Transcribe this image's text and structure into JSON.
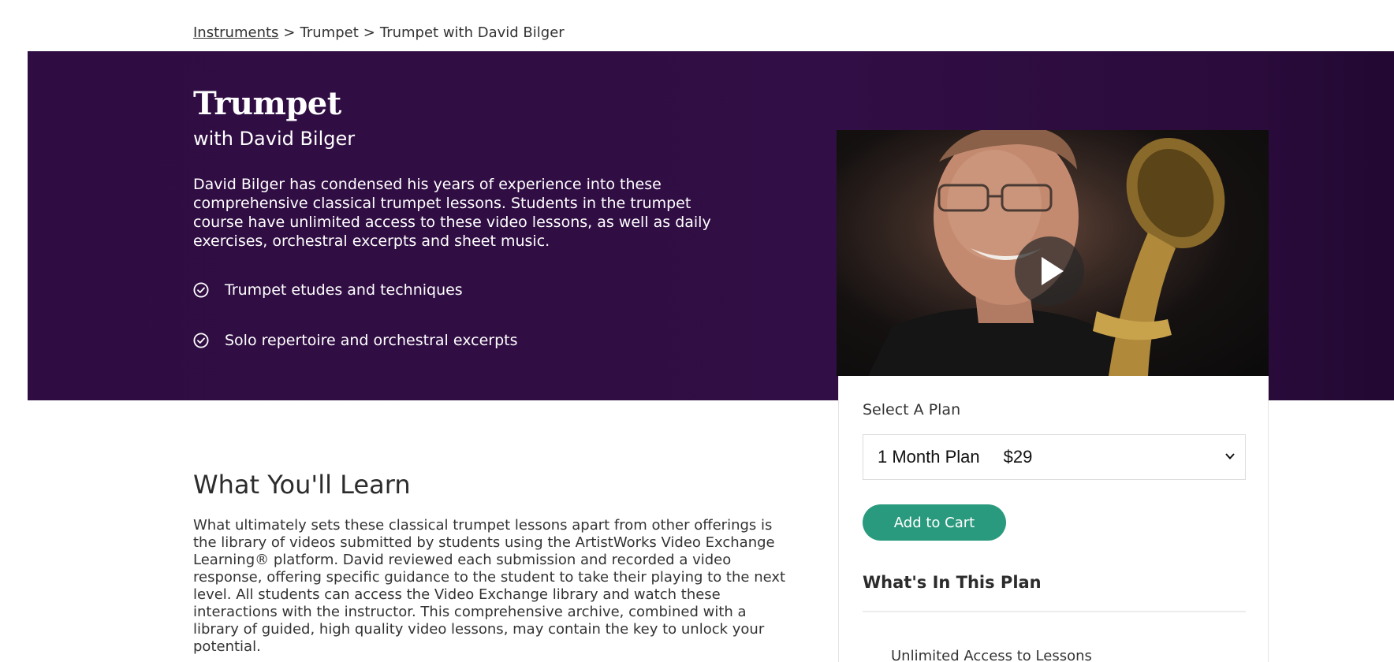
{
  "breadcrumb": {
    "items": [
      "Instruments",
      "Trumpet",
      "Trumpet with David Bilger"
    ],
    "separator": ">"
  },
  "hero": {
    "title": "Trumpet",
    "subtitle": "with David Bilger",
    "description": "David Bilger has condensed his years of experience into these comprehensive classical trumpet lessons. Students in the trumpet course have unlimited access to these video lessons, as well as daily exercises, orchestral excerpts and sheet music.",
    "features": [
      "Trumpet etudes and techniques",
      "Solo repertoire and orchestral excerpts"
    ],
    "colors": {
      "background": "#310e45"
    }
  },
  "video": {
    "play_icon": "play-icon"
  },
  "plan": {
    "label": "Select A Plan",
    "selected_plan": "1 Month Plan",
    "selected_price": "$29",
    "add_to_cart": "Add to Cart",
    "heading": "What's In This Plan",
    "items": [
      "Unlimited Access to Lessons"
    ],
    "colors": {
      "button": "#2a9a7e"
    }
  },
  "learn": {
    "title": "What You'll Learn",
    "body": "What ultimately sets these classical trumpet lessons apart from other offerings is the library of videos submitted by students using the ArtistWorks Video Exchange Learning® platform. David reviewed each submission and recorded a video response, offering specific guidance to the student to take their playing to the next level. All students can access the Video Exchange library and watch these interactions with the instructor. This comprehensive archive, combined with a library of guided, high quality video lessons, may contain the key to unlock your potential."
  }
}
